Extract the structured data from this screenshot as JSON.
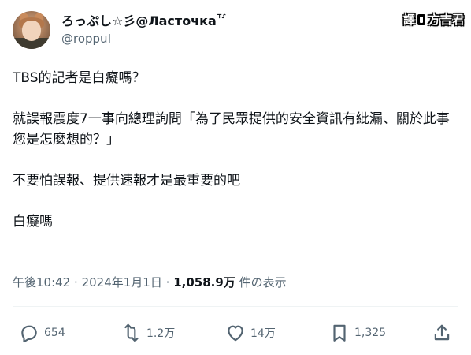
{
  "author": {
    "display_name": "ろっぷし☆彡@Ласточка",
    "name_decoration": "⸆⸉",
    "handle": "@roppuI"
  },
  "watermark": {
    "left": "譯",
    "right": "方吉君"
  },
  "tweet": {
    "paragraphs": [
      "TBS的記者是白癡嗎？",
      "就誤報震度7一事向總理詢問「為了民眾提供的安全資訊有紕漏、關於此事您是怎麼想的？」",
      "不要怕誤報、提供速報才是最重要的吧",
      "白癡嗎"
    ]
  },
  "meta": {
    "time": "午後10:42",
    "dot1": "·",
    "date": "2024年1月1日",
    "dot2": "·",
    "views_count": "1,058.9万",
    "views_label": "件の表示"
  },
  "actions": {
    "reply": {
      "icon": "reply-icon",
      "count": "654"
    },
    "retweet": {
      "icon": "retweet-icon",
      "count": "1.2万"
    },
    "like": {
      "icon": "heart-icon",
      "count": "14万"
    },
    "bookmark": {
      "icon": "bookmark-icon",
      "count": "1,325"
    },
    "share": {
      "icon": "share-icon"
    }
  }
}
